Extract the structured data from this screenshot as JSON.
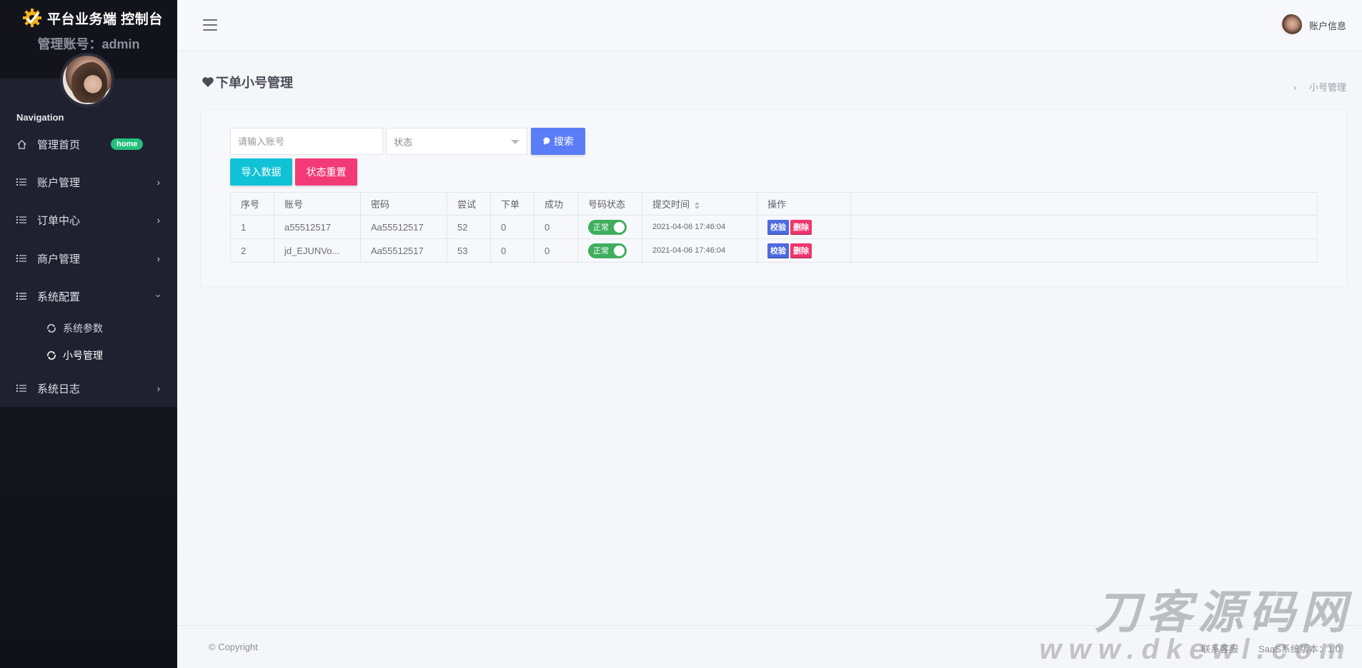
{
  "brand": {
    "title": "平台业务端 控制台",
    "admin_line": "管理账号：admin"
  },
  "sidebar": {
    "nav_label": "Navigation",
    "items": [
      {
        "label": "管理首页",
        "badge": "home"
      },
      {
        "label": "账户管理"
      },
      {
        "label": "订单中心"
      },
      {
        "label": "商户管理"
      },
      {
        "label": "系统配置",
        "expanded": true,
        "children": [
          {
            "label": "系统参数"
          },
          {
            "label": "小号管理",
            "active": true
          }
        ]
      },
      {
        "label": "系统日志"
      }
    ]
  },
  "header": {
    "account_label": "账户信息"
  },
  "page": {
    "title": "下单小号管理",
    "breadcrumb": "小号管理"
  },
  "filters": {
    "account_placeholder": "请输入账号",
    "status_placeholder": "状态",
    "search_label": "搜索",
    "import_label": "导入数据",
    "reset_label": "状态重置"
  },
  "table": {
    "columns": [
      "序号",
      "账号",
      "密码",
      "尝试",
      "下单",
      "成功",
      "号码状态",
      "提交时间",
      "操作"
    ],
    "rows": [
      {
        "index": "1",
        "account": "a55512517",
        "password": "Aa55512517",
        "tries": "52",
        "orders": "0",
        "success": "0",
        "status": "正常",
        "time": "2021-04-06 17:46:04"
      },
      {
        "index": "2",
        "account": "jd_EJUNVo...",
        "password": "Aa55512517",
        "tries": "53",
        "orders": "0",
        "success": "0",
        "status": "正常",
        "time": "2021-04-06 17:46:04"
      }
    ],
    "action_check": "校验",
    "action_delete": "删除"
  },
  "footer": {
    "copyright": "© Copyright",
    "contact": "联系客服",
    "version": "SaaS系统版本：1.0"
  },
  "watermark": {
    "line1": "刀客源码网",
    "line2": "www.dkewl.com"
  },
  "colors": {
    "primary": "#5b7cf7",
    "cyan": "#10c2d6",
    "pink": "#f23a76",
    "green": "#3fae5e",
    "sidebar": "#1f2130"
  }
}
